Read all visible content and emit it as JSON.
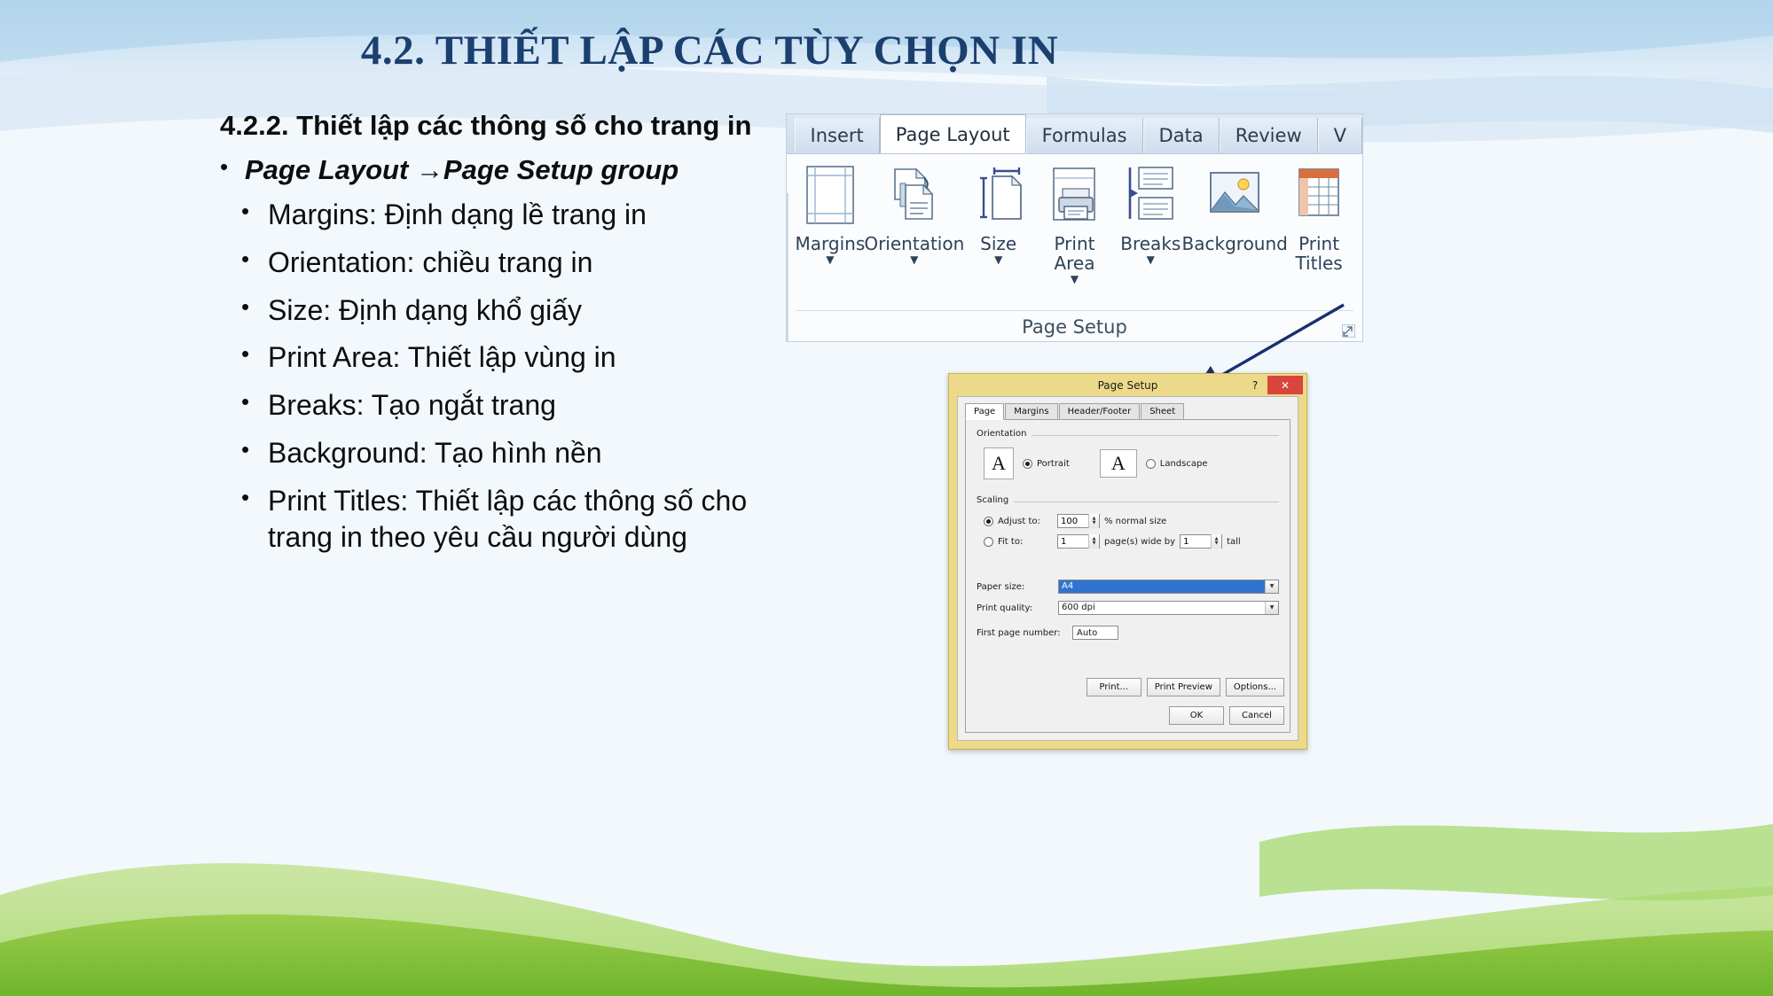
{
  "slide": {
    "title": "4.2. THIẾT LẬP CÁC TÙY CHỌN IN",
    "title_color": "#1b3f6e",
    "background_color": "#f2f8fc",
    "accent_green": "#86c440",
    "accent_blue": "#cfe4f5"
  },
  "content": {
    "heading": "4.2.2. Thiết lập các thông số cho trang in",
    "subheading_bullet": "•",
    "subheading": "Page Layout →Page Setup group",
    "bullet_char": "•",
    "items": [
      {
        "text": "Margins: Định dạng lề trang in"
      },
      {
        "text": "Orientation: chiều trang in"
      },
      {
        "text": "Size: Định dạng khổ giấy"
      },
      {
        "text": "Print Area: Thiết lập vùng in"
      },
      {
        "text": "Breaks: Tạo ngắt trang"
      },
      {
        "text": "Background: Tạo hình nền"
      },
      {
        "text": "Print Titles: Thiết lập các thông số cho",
        "cont": "trang in theo yêu cầu người dùng"
      }
    ]
  },
  "ribbon": {
    "tabs": [
      {
        "label": "Insert",
        "active": false
      },
      {
        "label": "Page Layout",
        "active": true
      },
      {
        "label": "Formulas",
        "active": false
      },
      {
        "label": "Data",
        "active": false
      },
      {
        "label": "Review",
        "active": false
      },
      {
        "label": "V",
        "active": false
      }
    ],
    "group_name": "Page Setup",
    "buttons": [
      {
        "label": "Margins",
        "icon": "margins-icon",
        "caret": "▼"
      },
      {
        "label": "Orientation",
        "icon": "orientation-icon",
        "caret": "▼"
      },
      {
        "label": "Size",
        "icon": "size-icon",
        "caret": "▼"
      },
      {
        "label": "Print\nArea",
        "icon": "print-area-icon",
        "caret": "▼"
      },
      {
        "label": "Breaks",
        "icon": "breaks-icon",
        "caret": "▼"
      },
      {
        "label": "Background",
        "icon": "background-icon",
        "caret": ""
      },
      {
        "label": "Print\nTitles",
        "icon": "print-titles-icon",
        "caret": ""
      }
    ],
    "launcher_icon": "dialog-launcher-icon"
  },
  "dialog": {
    "title": "Page Setup",
    "help_label": "?",
    "close_label": "✕",
    "close_color": "#d9453d",
    "frame_color": "#ecd98a",
    "tabs": [
      {
        "label": "Page",
        "active": true
      },
      {
        "label": "Margins",
        "active": false
      },
      {
        "label": "Header/Footer",
        "active": false
      },
      {
        "label": "Sheet",
        "active": false
      }
    ],
    "orientation": {
      "legend": "Orientation",
      "portrait_label": "Portrait",
      "portrait_selected": true,
      "landscape_label": "Landscape",
      "landscape_selected": false,
      "icon_glyph": "A"
    },
    "scaling": {
      "legend": "Scaling",
      "adjust_label": "Adjust to:",
      "adjust_selected": true,
      "adjust_value": "100",
      "adjust_suffix": "% normal size",
      "fit_label": "Fit to:",
      "fit_selected": false,
      "fit_wide_value": "1",
      "fit_mid_label": "page(s) wide by",
      "fit_tall_value": "1",
      "fit_suffix": "tall"
    },
    "paper_size": {
      "label": "Paper size:",
      "value": "A4"
    },
    "print_quality": {
      "label": "Print quality:",
      "value": "600 dpi"
    },
    "first_page_number": {
      "label": "First page number:",
      "value": "Auto"
    },
    "buttons": {
      "print": "Print...",
      "print_preview": "Print Preview",
      "options": "Options...",
      "ok": "OK",
      "cancel": "Cancel"
    }
  }
}
